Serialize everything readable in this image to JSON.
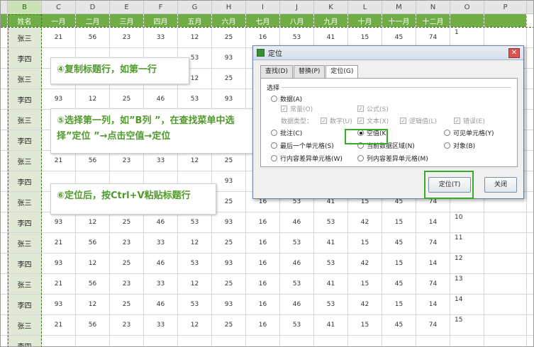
{
  "columns": [
    "B",
    "C",
    "D",
    "E",
    "F",
    "G",
    "H",
    "I",
    "J",
    "K",
    "L",
    "M",
    "N",
    "O",
    "P"
  ],
  "header_row": [
    "姓名",
    "一月",
    "二月",
    "三月",
    "四月",
    "五月",
    "六月",
    "七月",
    "八月",
    "九月",
    "十月",
    "十一月",
    "十二月"
  ],
  "rows": [
    {
      "name": "张三",
      "vals": [
        "21",
        "56",
        "23",
        "33",
        "12",
        "25",
        "16",
        "53",
        "41",
        "15",
        "45",
        "74"
      ],
      "idx": "1"
    },
    {
      "name": "李四",
      "vals": [
        "",
        "",
        "",
        "",
        "53",
        "93",
        "",
        "",
        "",
        "",
        "",
        ""
      ],
      "idx": ""
    },
    {
      "name": "张三",
      "vals": [
        "",
        "",
        "",
        "",
        "12",
        "25",
        "",
        "",
        "",
        "",
        "",
        ""
      ],
      "idx": ""
    },
    {
      "name": "李四",
      "vals": [
        "93",
        "12",
        "25",
        "46",
        "53",
        "93",
        "",
        "",
        "",
        "",
        "",
        ""
      ],
      "idx": ""
    },
    {
      "name": "张三",
      "vals": [
        "",
        "",
        "",
        "",
        "",
        "",
        "",
        "",
        "",
        "",
        "",
        ""
      ],
      "idx": ""
    },
    {
      "name": "李四",
      "vals": [
        "",
        "",
        "",
        "",
        "",
        "",
        "",
        "",
        "",
        "",
        "",
        ""
      ],
      "idx": ""
    },
    {
      "name": "张三",
      "vals": [
        "21",
        "56",
        "23",
        "33",
        "12",
        "25",
        "",
        "",
        "",
        "",
        "",
        ""
      ],
      "idx": ""
    },
    {
      "name": "李四",
      "vals": [
        "",
        "",
        "",
        "",
        "",
        "93",
        "",
        "",
        "",
        "",
        "",
        ""
      ],
      "idx": "8"
    },
    {
      "name": "张三",
      "vals": [
        "",
        "",
        "",
        "",
        "",
        "25",
        "16",
        "53",
        "41",
        "15",
        "45",
        "74"
      ],
      "idx": "9"
    },
    {
      "name": "李四",
      "vals": [
        "93",
        "12",
        "25",
        "46",
        "53",
        "93",
        "16",
        "46",
        "53",
        "42",
        "15",
        "14"
      ],
      "idx": "10"
    },
    {
      "name": "张三",
      "vals": [
        "21",
        "56",
        "23",
        "33",
        "12",
        "25",
        "16",
        "53",
        "41",
        "15",
        "45",
        "74"
      ],
      "idx": "11"
    },
    {
      "name": "李四",
      "vals": [
        "93",
        "12",
        "25",
        "46",
        "53",
        "93",
        "16",
        "46",
        "53",
        "42",
        "15",
        "14"
      ],
      "idx": "12"
    },
    {
      "name": "张三",
      "vals": [
        "21",
        "56",
        "23",
        "33",
        "12",
        "25",
        "16",
        "53",
        "41",
        "15",
        "45",
        "74"
      ],
      "idx": "13"
    },
    {
      "name": "李四",
      "vals": [
        "93",
        "12",
        "25",
        "46",
        "53",
        "93",
        "16",
        "46",
        "53",
        "42",
        "15",
        "14"
      ],
      "idx": "14"
    },
    {
      "name": "张三",
      "vals": [
        "21",
        "56",
        "23",
        "33",
        "12",
        "25",
        "16",
        "53",
        "41",
        "15",
        "45",
        "74"
      ],
      "idx": "15"
    },
    {
      "name": "李四",
      "vals": [
        "",
        "",
        "",
        "",
        "",
        "",
        "",
        "",
        "",
        "",
        "",
        ""
      ],
      "idx": ""
    }
  ],
  "callouts": {
    "step4": "④复制标题行，如第一行",
    "step5": "⑤选择第一列，如”B列 ”，在查找菜单中选择”定位 ”→点击空值→定位",
    "step6": "⑥定位后，按Ctrl+V粘贴标题行"
  },
  "dialog": {
    "title": "定位",
    "close_icon": "close-icon",
    "tabs": [
      "查找(D)",
      "替换(P)",
      "定位(G)"
    ],
    "group_label": "选择",
    "options": {
      "data": "数据(A)",
      "constant": "常量(O)",
      "formula": "公式(S)",
      "data_type": "数据类型：",
      "number": "数字(U)",
      "text": "文本(X)",
      "logical": "逻辑值(L)",
      "error": "错误(E)",
      "comment": "批注(C)",
      "blank": "空值(K)",
      "visible_cells": "可见单元格(Y)",
      "last_cell": "最后一个单元格(S)",
      "current_array": "当前数据区域(N)",
      "objects": "对象(B)",
      "row_diff": "行内容差异单元格(W)",
      "col_diff": "列内容差异单元格(M)"
    },
    "locate_button": "定位(T)",
    "close_button": "关闭"
  },
  "colors": {
    "header_green": "#70ad47",
    "callout_text": "#4f9a2a",
    "highlight": "#3aaa2a"
  }
}
